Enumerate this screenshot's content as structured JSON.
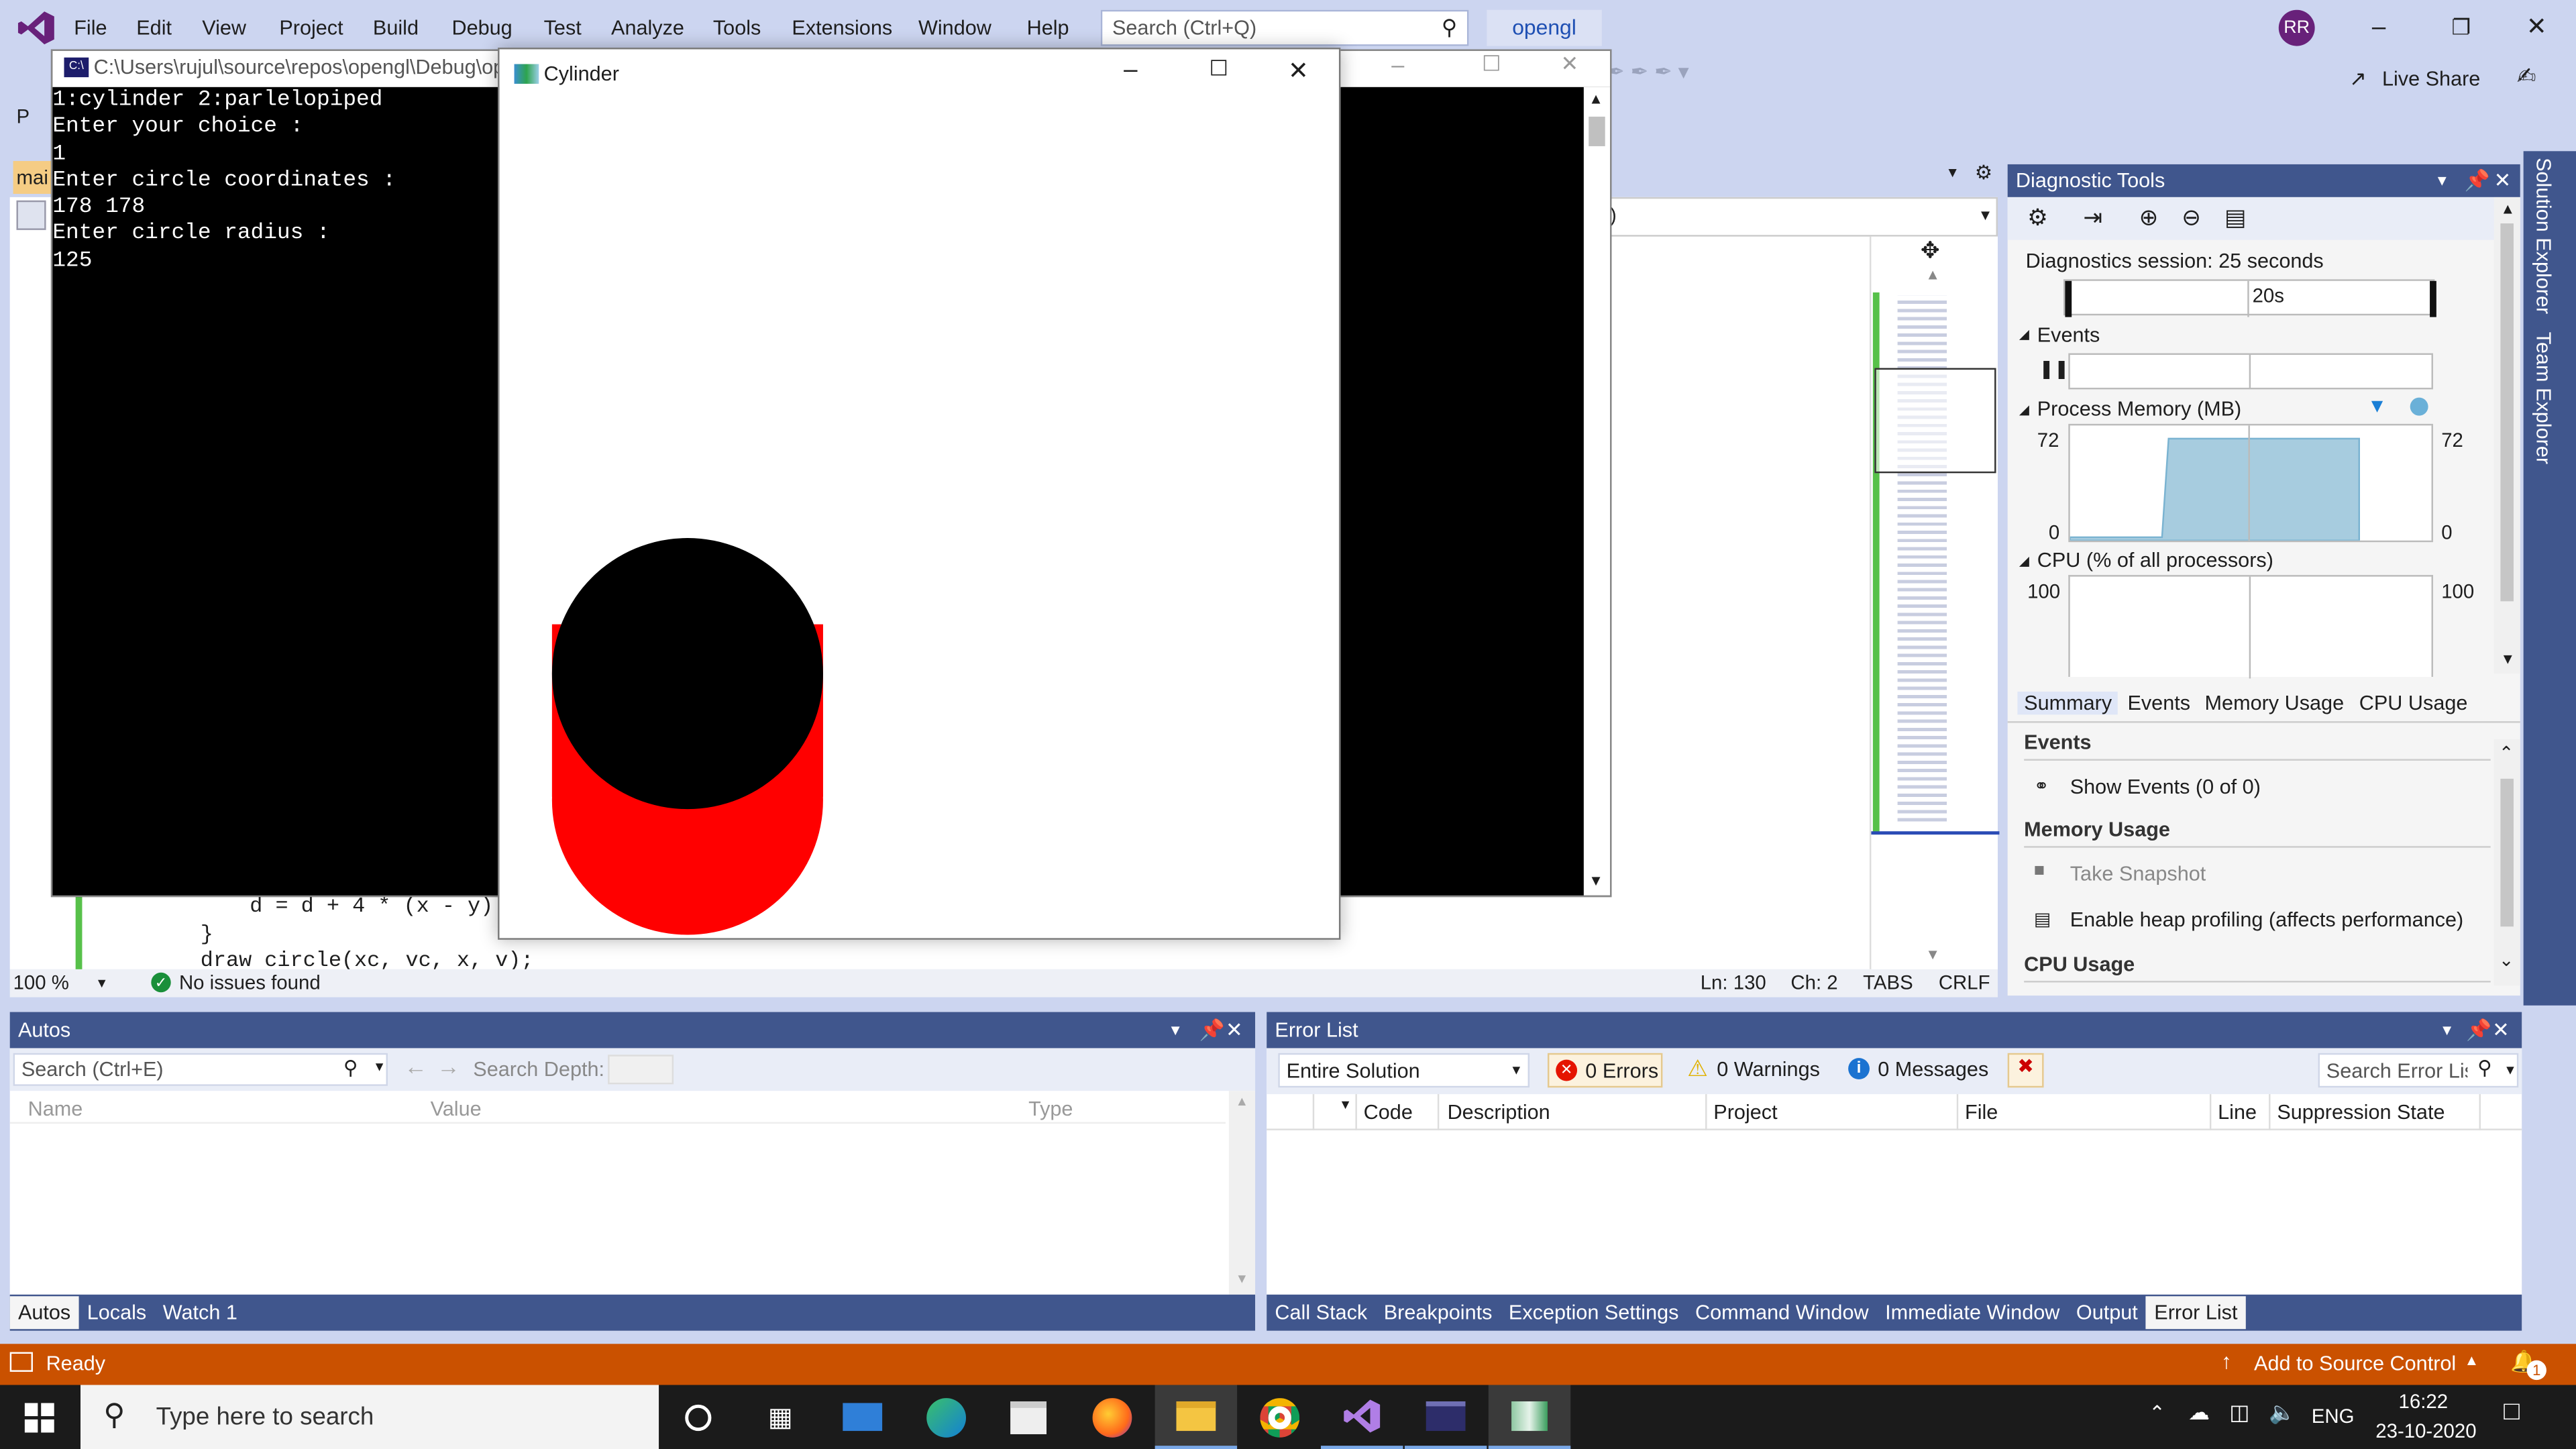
{
  "menu": [
    "File",
    "Edit",
    "View",
    "Project",
    "Build",
    "Debug",
    "Test",
    "Analyze",
    "Tools",
    "Extensions",
    "Window",
    "Help"
  ],
  "search_placeholder": "Search (Ctrl+Q)",
  "solution_name": "opengl",
  "user_initials": "RR",
  "live_share": "Live Share",
  "console": {
    "title": "C:\\Users\\rujul\\source\\repos\\opengl\\Debug\\op",
    "lines": [
      "1:cylinder 2:parlelopiped",
      "Enter your choice :",
      "1",
      "Enter circle coordinates :",
      "178 178",
      "Enter circle radius :",
      "125"
    ]
  },
  "glwin": {
    "title": "Cylinder"
  },
  "editor": {
    "code_lines": [
      "d = d + 4 * (x - y) +",
      "}",
      "draw circle(xc, vc, x, v);"
    ],
    "zoom": "100 %",
    "issues": "No issues found",
    "ln": "Ln: 130",
    "ch": "Ch: 2",
    "tabs": "TABS",
    "eol": "CRLF",
    "partial_tab": "mai",
    "partial_left": "P"
  },
  "diag": {
    "title": "Diagnostic Tools",
    "session": "Diagnostics session: 25 seconds",
    "tick": "20s",
    "events_label": "Events",
    "mem_label": "Process Memory (MB)",
    "mem_max": "72",
    "mem_min": "0",
    "cpu_label": "CPU (% of all processors)",
    "cpu_max": "100",
    "tabs": [
      "Summary",
      "Events",
      "Memory Usage",
      "CPU Usage"
    ],
    "sec_events": "Events",
    "show_events": "Show Events (0 of 0)",
    "sec_memory": "Memory Usage",
    "take_snapshot": "Take Snapshot",
    "heap": "Enable heap profiling (affects performance)",
    "sec_cpu": "CPU Usage"
  },
  "side_tabs": [
    "Solution Explorer",
    "Team Explorer"
  ],
  "autos": {
    "title": "Autos",
    "search": "Search (Ctrl+E)",
    "depth": "Search Depth:",
    "cols": [
      "Name",
      "Value",
      "Type"
    ],
    "tabs": [
      "Autos",
      "Locals",
      "Watch 1"
    ]
  },
  "errors": {
    "title": "Error List",
    "scope": "Entire Solution",
    "errors": "0 Errors",
    "warnings": "0 Warnings",
    "messages": "0 Messages",
    "search": "Search Error Lis",
    "cols": [
      "Code",
      "Description",
      "Project",
      "File",
      "Line",
      "Suppression State"
    ],
    "tabs": [
      "Call Stack",
      "Breakpoints",
      "Exception Settings",
      "Command Window",
      "Immediate Window",
      "Output",
      "Error List"
    ]
  },
  "status": {
    "ready": "Ready",
    "source": "Add to Source Control",
    "notif": "1"
  },
  "taskbar": {
    "search": "Type here to search",
    "lang": "ENG",
    "time": "16:22",
    "date": "23-10-2020"
  },
  "colors": {
    "vs_purple": "#68217a",
    "title_bg": "#ccd5f0",
    "panel_title": "#40568d",
    "status_debug": "#ca5100",
    "taskbar": "#1b1b1b",
    "cyl_red": "#ff0000",
    "cyl_top": "#000000"
  }
}
